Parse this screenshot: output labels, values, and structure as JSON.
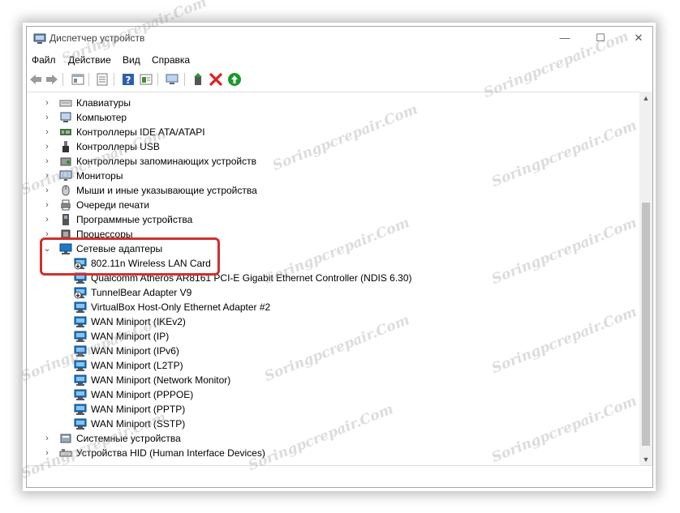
{
  "window": {
    "title": "Диспетчер устройств",
    "controls": {
      "minimize": "—",
      "maximize": "☐",
      "close": "✕"
    }
  },
  "menu": [
    "Файл",
    "Действие",
    "Вид",
    "Справка"
  ],
  "toolbar": {
    "buttons": [
      "back-icon",
      "forward-icon",
      "properties-icon",
      "list-icon",
      "help-icon",
      "view-icon",
      "monitor-icon",
      "update-driver-icon",
      "remove-device-icon",
      "enable-device-icon"
    ]
  },
  "tree": {
    "categories": [
      {
        "label": "Клавиатуры",
        "icon": "keyboard-icon",
        "expanded": false
      },
      {
        "label": "Компьютер",
        "icon": "computer-icon",
        "expanded": false
      },
      {
        "label": "Контроллеры IDE ATA/ATAPI",
        "icon": "ide-controller-icon",
        "expanded": false
      },
      {
        "label": "Контроллеры USB",
        "icon": "usb-icon",
        "expanded": false
      },
      {
        "label": "Контроллеры запоминающих устройств",
        "icon": "storage-controller-icon",
        "expanded": false
      },
      {
        "label": "Мониторы",
        "icon": "monitor-icon",
        "expanded": false
      },
      {
        "label": "Мыши и иные указывающие устройства",
        "icon": "mouse-icon",
        "expanded": false
      },
      {
        "label": "Очереди печати",
        "icon": "printer-icon",
        "expanded": false
      },
      {
        "label": "Программные устройства",
        "icon": "software-device-icon",
        "expanded": false
      },
      {
        "label": "Процессоры",
        "icon": "processor-icon",
        "expanded": false
      },
      {
        "label": "Сетевые адаптеры",
        "icon": "network-adapter-icon",
        "expanded": true
      }
    ],
    "network_adapters": [
      {
        "label": "802.11n Wireless LAN Card",
        "disabled": true
      },
      {
        "label": "Qualcomm Atheros AR8161 PCI-E Gigabit Ethernet Controller (NDIS 6.30)",
        "disabled": false
      },
      {
        "label": "TunnelBear Adapter V9",
        "disabled": true
      },
      {
        "label": "VirtualBox Host-Only Ethernet Adapter #2",
        "disabled": false
      },
      {
        "label": "WAN Miniport (IKEv2)",
        "disabled": false
      },
      {
        "label": "WAN Miniport (IP)",
        "disabled": false
      },
      {
        "label": "WAN Miniport (IPv6)",
        "disabled": false
      },
      {
        "label": "WAN Miniport (L2TP)",
        "disabled": false
      },
      {
        "label": "WAN Miniport (Network Monitor)",
        "disabled": false
      },
      {
        "label": "WAN Miniport (PPPOE)",
        "disabled": false
      },
      {
        "label": "WAN Miniport (PPTP)",
        "disabled": false
      },
      {
        "label": "WAN Miniport (SSTP)",
        "disabled": false
      }
    ],
    "after": [
      {
        "label": "Системные устройства",
        "icon": "system-device-icon",
        "expanded": false
      },
      {
        "label": "Устройства HID (Human Interface Devices)",
        "icon": "hid-icon",
        "expanded": false
      }
    ]
  },
  "watermark": "Soringpcrepair.Com",
  "colors": {
    "highlight": "#d0302f",
    "remove": "#e02020",
    "enable": "#1a9a2a",
    "network": "#1e78c8"
  }
}
